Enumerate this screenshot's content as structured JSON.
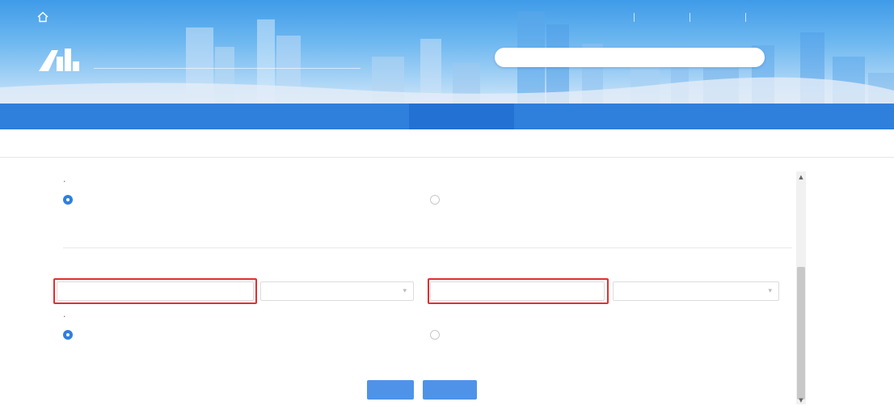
{
  "colors": {
    "primary": "#2f7fdc",
    "nav_active": "#2371d2",
    "highlight": "#e03030",
    "button": "#4f93e8"
  },
  "header": {
    "welcome_text": "",
    "top_links": [
      "",
      "",
      ""
    ],
    "site_title": "",
    "search": {
      "placeholder": "",
      "value": ""
    },
    "quick_links": [
      "",
      "",
      "",
      "",
      ""
    ]
  },
  "nav": {
    "items": [
      {
        "label": "",
        "active": false
      },
      {
        "label": "",
        "active": false
      },
      {
        "label": "",
        "active": false
      },
      {
        "label": "",
        "active": false
      },
      {
        "label": "",
        "active": true
      },
      {
        "label": "",
        "active": false
      },
      {
        "label": "",
        "active": false
      }
    ]
  },
  "breadcrumb": {
    "text": ""
  },
  "form": {
    "apply_type": {
      "label": "",
      "options": [
        {
          "label": "",
          "checked": true
        },
        {
          "label": "",
          "checked": false
        }
      ]
    },
    "section_title": "",
    "apply_name": {
      "label": "",
      "placeholder": "",
      "select_value": ""
    },
    "apply_person": {
      "label": "",
      "placeholder": "",
      "select_value": ""
    },
    "confirm": {
      "label": "",
      "options": [
        {
          "label": "",
          "checked": true
        },
        {
          "label": "",
          "checked": false
        }
      ]
    }
  },
  "buttons": {
    "back": "",
    "next": ""
  },
  "icons": {
    "home": "home-icon",
    "logo": "building-logo-icon",
    "caret": "chevron-down-icon"
  }
}
